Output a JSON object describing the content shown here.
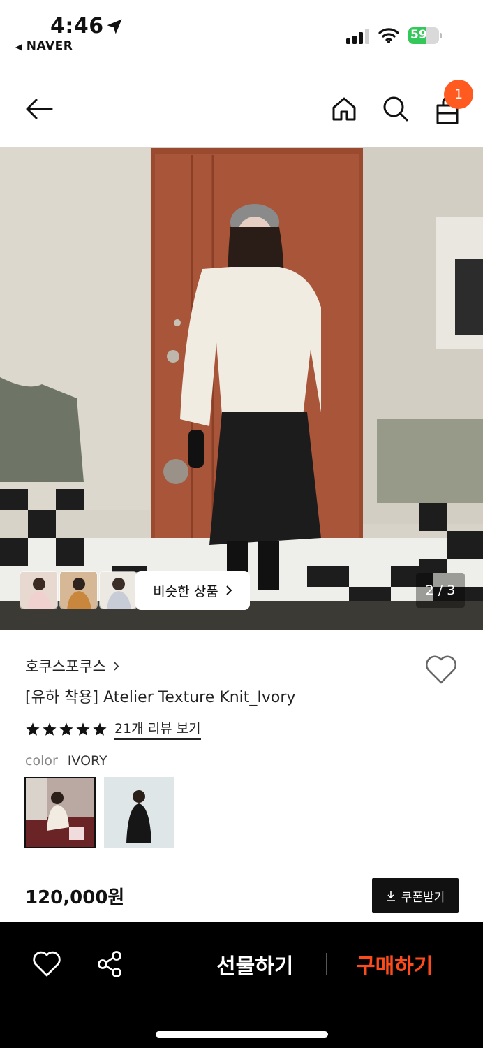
{
  "status_bar": {
    "time": "4:46",
    "back_app": "NAVER",
    "battery": "59",
    "battery_level": 0.59,
    "icons": [
      "location-arrow-icon",
      "signal-icon",
      "wifi-icon",
      "battery-icon"
    ]
  },
  "nav": {
    "icons": [
      "back-arrow-icon",
      "home-icon",
      "search-icon",
      "cart-icon"
    ],
    "cart_count": "1"
  },
  "gallery": {
    "similar_button": "비슷한 상품",
    "page_indicator": "2 / 3"
  },
  "product": {
    "brand": "호쿠스포쿠스",
    "title": "[유하 착용] Atelier Texture Knit_Ivory",
    "rating_stars": 5,
    "review_link": "21개 리뷰 보기",
    "color_label": "color",
    "color_value": "IVORY",
    "price": "120,000원",
    "coupon_button": "쿠폰받기"
  },
  "bottom_bar": {
    "gift_label": "선물하기",
    "buy_label": "구매하기"
  },
  "colors": {
    "accent_orange": "#ff5a1f",
    "buy_orange": "#ff4b1c",
    "bar_black": "#000000"
  }
}
